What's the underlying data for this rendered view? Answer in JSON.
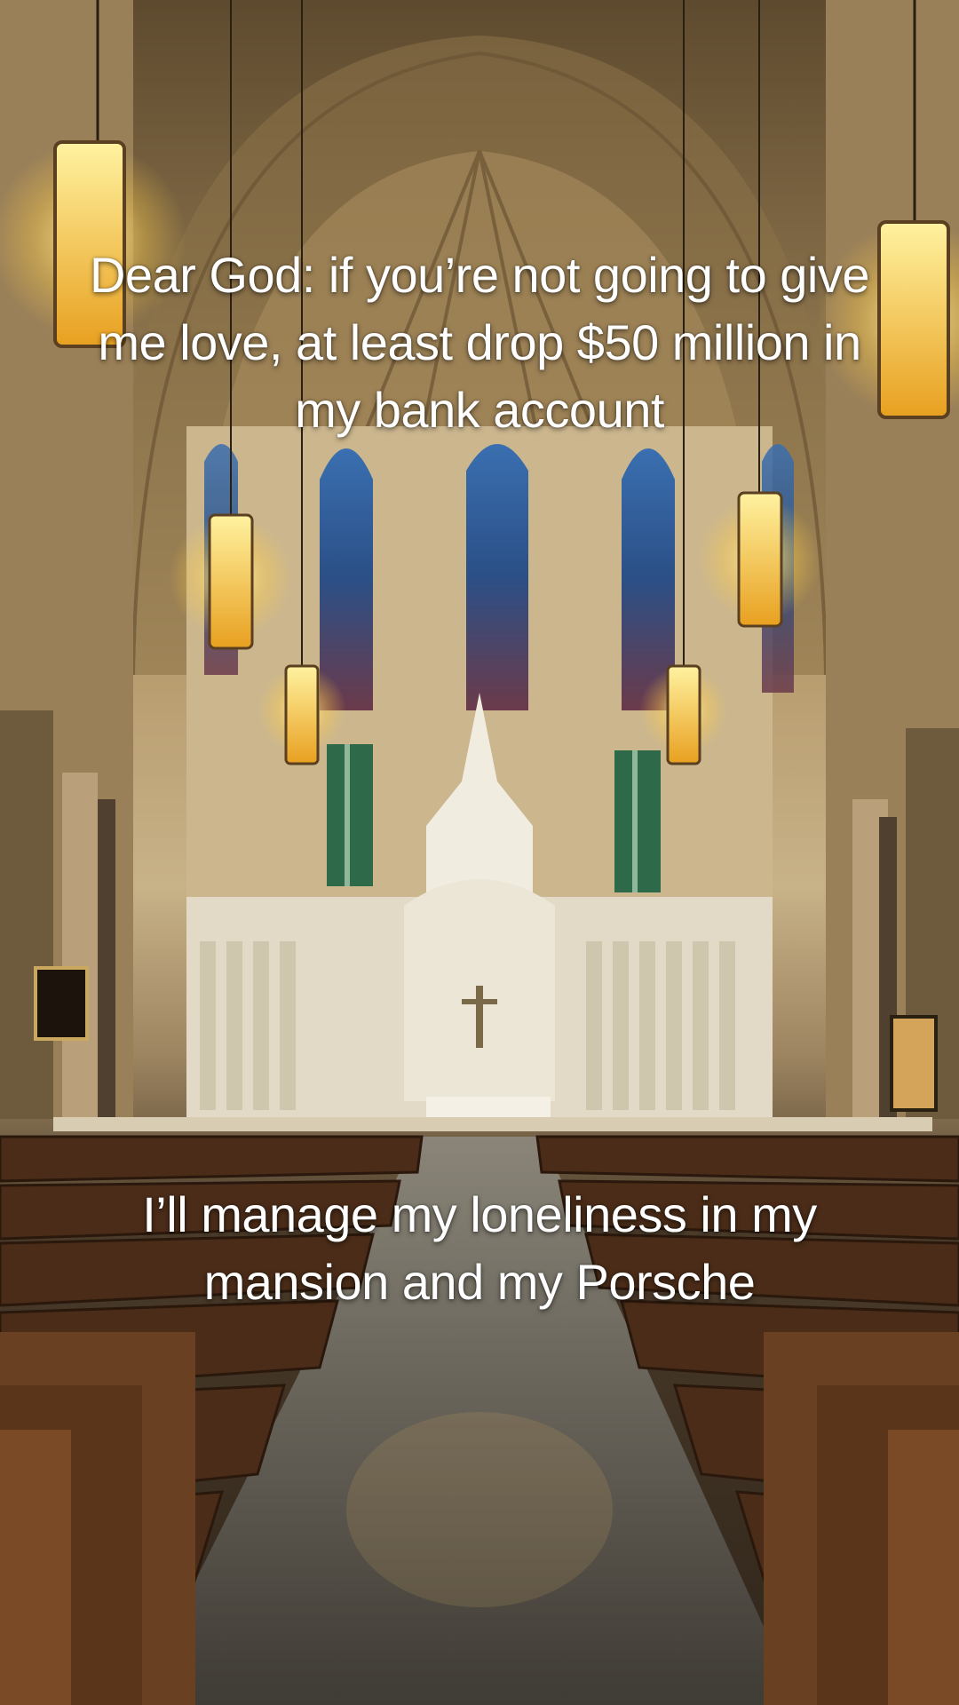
{
  "captions": {
    "top": "Dear God: if you’re not going to give me love, at least drop $50 million in my bank account",
    "bottom": "I’ll manage my loneliness in my mansion and my Porsche"
  },
  "scene": {
    "subject": "church interior",
    "colors": {
      "stone": "#c9b48c",
      "ceiling": "#7a6240",
      "lamp_glow": "#ffcf4a",
      "pew_wood": "#4a2c18",
      "floor": "#5a5650",
      "altar": "#e8e2d2",
      "glass_blue": "#2f5f9e"
    }
  }
}
